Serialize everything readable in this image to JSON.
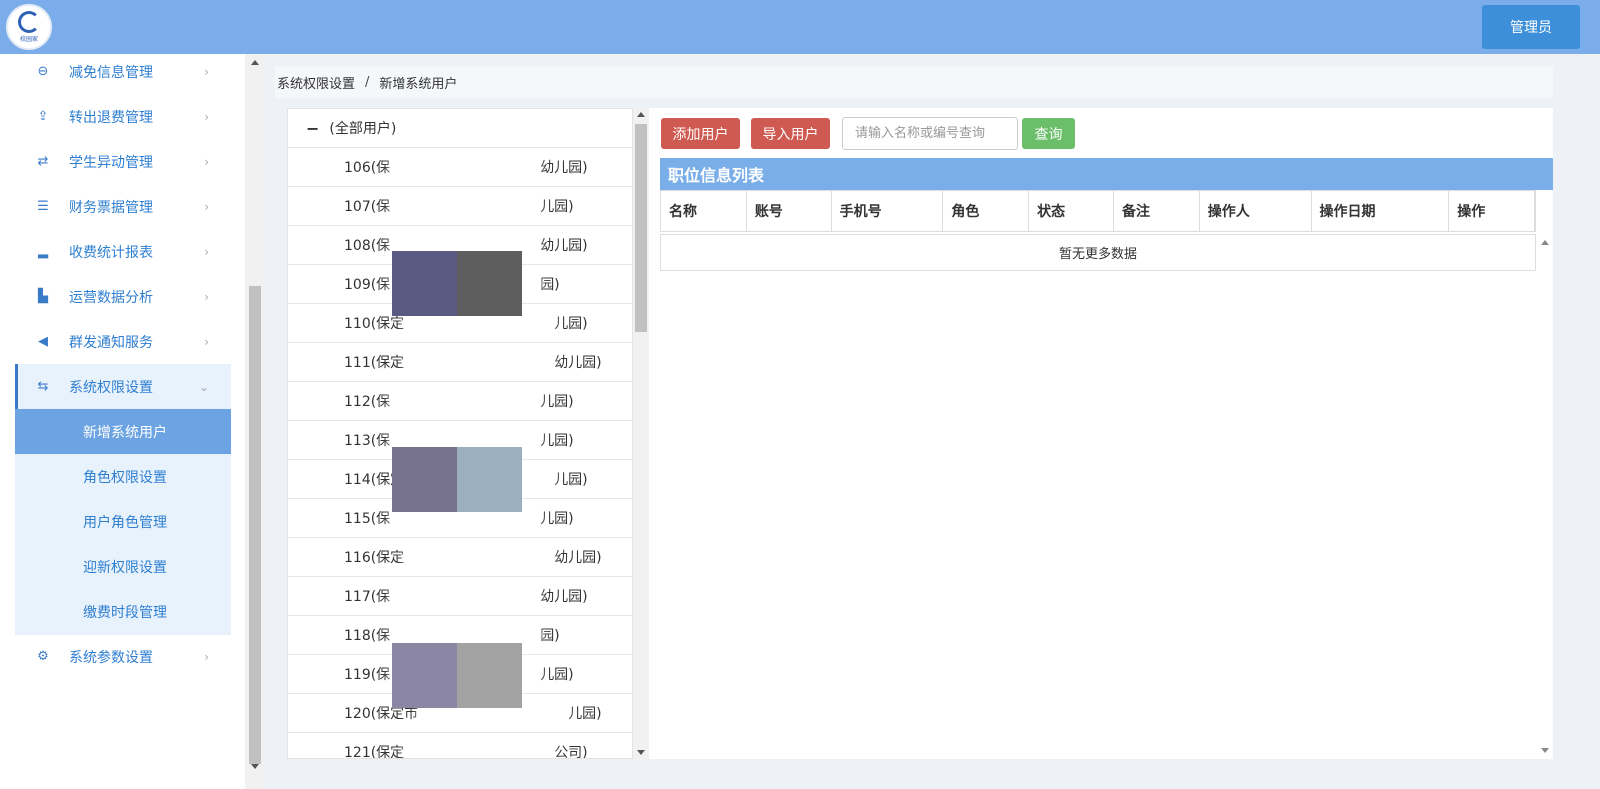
{
  "header": {
    "logo_text": "校园家",
    "app_title": "",
    "admin_label": "管理员"
  },
  "sidebar": {
    "items": [
      {
        "label": "减免信息管理",
        "icon": "minus-circle-icon",
        "glyph": "⊖"
      },
      {
        "label": "转出退费管理",
        "icon": "upload-icon",
        "glyph": "⇪"
      },
      {
        "label": "学生异动管理",
        "icon": "exchange-icon",
        "glyph": "⇄"
      },
      {
        "label": "财务票据管理",
        "icon": "server-icon",
        "glyph": "☰"
      },
      {
        "label": "收费统计报表",
        "icon": "signal-icon",
        "glyph": "▂"
      },
      {
        "label": "运营数据分析",
        "icon": "bar-chart-icon",
        "glyph": "▙"
      },
      {
        "label": "群发通知服务",
        "icon": "volume-icon",
        "glyph": "◀"
      },
      {
        "label": "系统权限设置",
        "icon": "retweet-icon",
        "glyph": "⇆"
      },
      {
        "label": "系统参数设置",
        "icon": "gear-icon",
        "glyph": "⚙"
      }
    ],
    "sub_items": [
      {
        "label": "新增系统用户"
      },
      {
        "label": "角色权限设置"
      },
      {
        "label": "用户角色管理"
      },
      {
        "label": "迎新权限设置"
      },
      {
        "label": "缴费时段管理"
      }
    ]
  },
  "breadcrumb": {
    "parent": "系统权限设置",
    "separator": "/",
    "current": "新增系统用户"
  },
  "tree": {
    "root_label": "(全部用户)",
    "rows": [
      {
        "prefix": "106(保",
        "suffix": "幼儿园)"
      },
      {
        "prefix": "107(保",
        "suffix": "儿园)"
      },
      {
        "prefix": "108(保",
        "suffix": "幼儿园)"
      },
      {
        "prefix": "109(保",
        "suffix": "园)"
      },
      {
        "prefix": "110(保定",
        "suffix": "儿园)"
      },
      {
        "prefix": "111(保定",
        "suffix": "幼儿园)"
      },
      {
        "prefix": "112(保",
        "suffix": "儿园)"
      },
      {
        "prefix": "113(保",
        "suffix": "儿园)"
      },
      {
        "prefix": "114(保定",
        "suffix": "儿园)"
      },
      {
        "prefix": "115(保",
        "suffix": "儿园)"
      },
      {
        "prefix": "116(保定",
        "suffix": "幼儿园)"
      },
      {
        "prefix": "117(保",
        "suffix": "幼儿园)"
      },
      {
        "prefix": "118(保",
        "suffix": "园)"
      },
      {
        "prefix": "119(保",
        "suffix": "儿园)"
      },
      {
        "prefix": "120(保定市",
        "suffix": "儿园)"
      },
      {
        "prefix": "121(保定",
        "suffix": "公司)"
      }
    ]
  },
  "toolbar": {
    "add_user": "添加用户",
    "import_user": "导入用户",
    "search_placeholder": "请输入名称或编号查询",
    "query": "查询"
  },
  "table": {
    "title": "职位信息列表",
    "columns": [
      "名称",
      "账号",
      "手机号",
      "角色",
      "状态",
      "备注",
      "操作人",
      "操作日期",
      "操作"
    ],
    "empty_text": "暂无更多数据"
  },
  "colors": {
    "header_bg": "#7badea",
    "accent_blue": "#3a7bc8",
    "button_red": "#cf5a52",
    "button_green": "#6bbf6b"
  }
}
